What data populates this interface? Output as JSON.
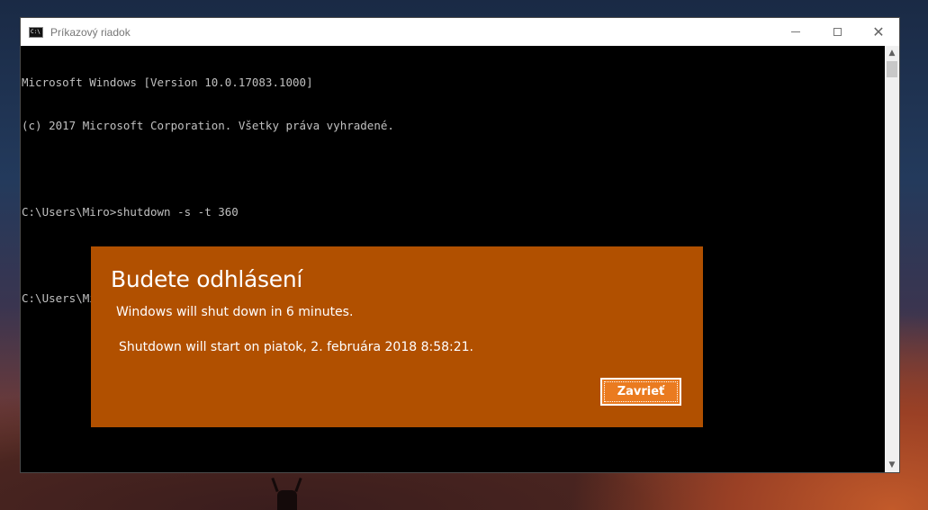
{
  "window": {
    "title": "Príkazový riadok",
    "icon": "cmd-icon"
  },
  "console": {
    "lines": [
      "Microsoft Windows [Version 10.0.17083.1000]",
      "(c) 2017 Microsoft Corporation. Všetky práva vyhradené.",
      "",
      "C:\\Users\\Miro>shutdown -s -t 360",
      "",
      "C:\\Users\\Miro>"
    ]
  },
  "dialog": {
    "title": "Budete odhlásení",
    "message": "Windows will shut down in 6 minutes.",
    "detail": "Shutdown will start on piatok, 2. februára 2018 8:58:21.",
    "close_label": "Zavrieť",
    "accent": "#b15000",
    "button_color": "#ea7b20"
  },
  "colors": {
    "console_bg": "#000000",
    "console_text": "#c0c0c0"
  }
}
